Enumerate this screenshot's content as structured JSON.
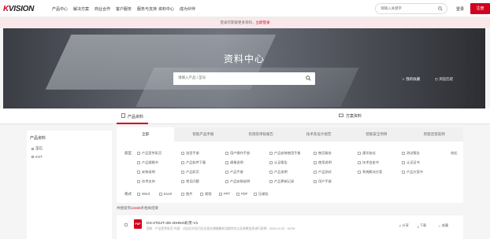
{
  "header": {
    "logo_prefix": "K",
    "logo_rest": "VISION",
    "nav": [
      "产品中心",
      "解决方案",
      "商业合作",
      "客户服务",
      "服务与支持",
      "资料中心",
      "成为伙伴"
    ],
    "search_placeholder": "请输入关键字",
    "login": "登录",
    "register": "注册"
  },
  "notice": {
    "text": "登录可获取更多资料，",
    "link": "立即登录"
  },
  "hero": {
    "title": "资料中心",
    "search_placeholder": "请输入产品 / 型号",
    "link_fav": "我的收藏",
    "link_history": "浏览历史"
  },
  "tabs": [
    {
      "label": "产品资料",
      "icon": "document-icon"
    },
    {
      "label": "方案资料",
      "icon": "folder-icon"
    }
  ],
  "sidebar": {
    "heading": "产品资料",
    "items": [
      "萤石",
      "KST"
    ]
  },
  "filter_tabs": [
    "全部",
    "智能产品手册",
    "检测及审核报告",
    "技术及设计规范",
    "智能安全项目",
    "智能连锁案例"
  ],
  "filters": {
    "row1_label": "类型",
    "types": [
      "产品宣传彩页",
      "选型手册",
      "用户操作手册",
      "产品安装使用手册",
      "售后服务",
      "通讯协议",
      "测试报告",
      "产品规格书",
      "产品软件下载",
      "规格说明",
      "认证报告",
      "使用说明",
      "技术白皮书",
      "认证证书",
      "安装说明",
      "产品彩页",
      "产品手册",
      "产品说明",
      "产品测试",
      "系统解决方案",
      "产品方案书",
      "技术支持",
      "常见问题",
      "产品安装说明",
      "产品更新记录",
      "用户手册"
    ],
    "collapse": "收起",
    "row2_label": "格式",
    "formats": [
      "Word",
      "Excel",
      "图片",
      "视频",
      "PPT",
      "PDF",
      "压缩包"
    ]
  },
  "results": {
    "count_prefix": "共搜索到",
    "count": "13155",
    "count_suffix": "条相关结果",
    "items": [
      {
        "badge": "PDF",
        "title": "DS-2TD2T-3/8 40HNO彩页-V1",
        "meta": "资料 · 产品宣传彩页  内容：对远红外及可见光双光谱摄像机功能特点以及参数信息进行说明 · 2025-04-30 · 307M",
        "actions": [
          "分享",
          "下载",
          "收藏"
        ]
      }
    ]
  }
}
